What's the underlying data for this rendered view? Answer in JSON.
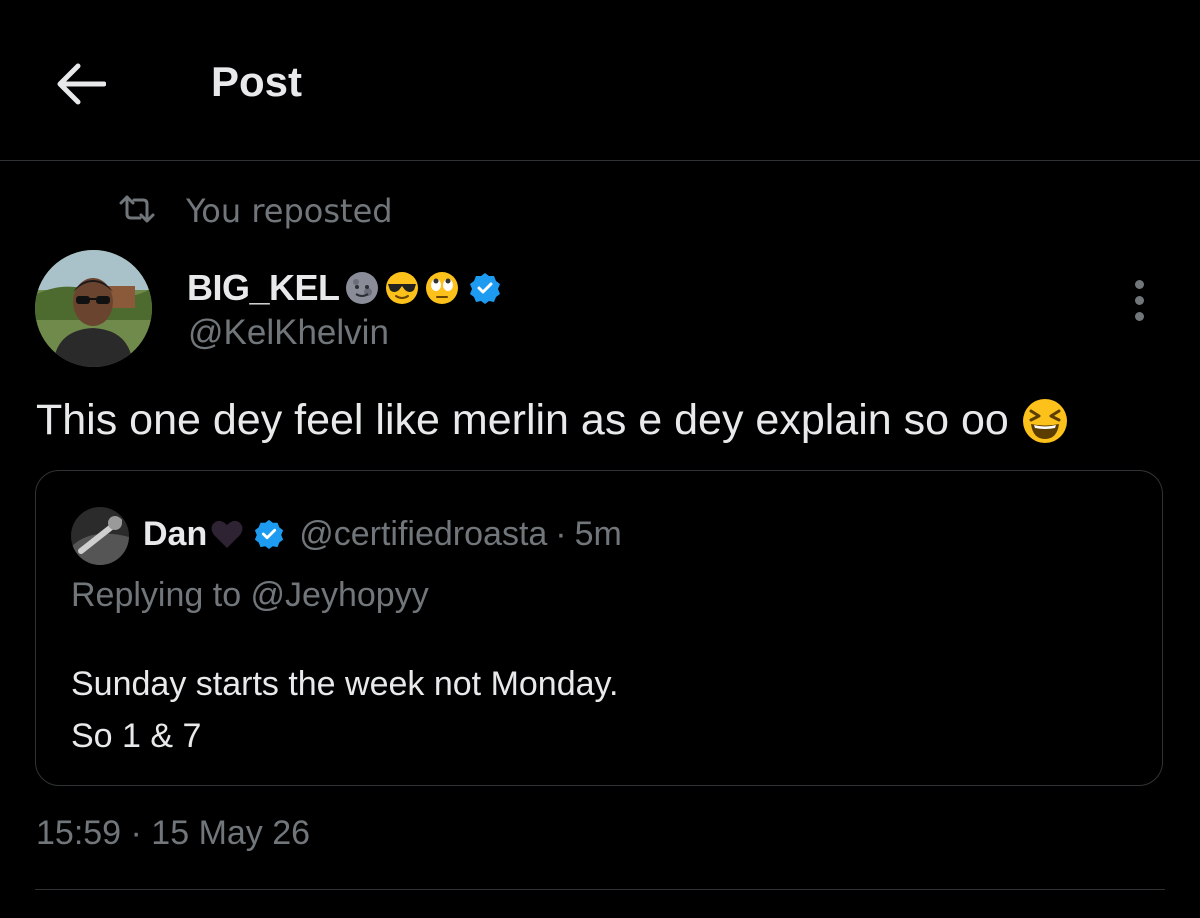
{
  "header": {
    "title": "Post",
    "back_icon": "arrow-left-icon"
  },
  "repost": {
    "icon": "repost-icon",
    "text": "You reposted"
  },
  "author": {
    "name": "BIG_KEL",
    "name_emojis": [
      "new-moon-face-emoji",
      "sunglasses-face-emoji",
      "eye-roll-face-emoji"
    ],
    "verified": true,
    "handle": "@KelKhelvin",
    "more_icon": "more-vertical-icon"
  },
  "tweet": {
    "text": "This one dey feel like merlin as e dey explain so oo",
    "trailing_emoji": "laughing-squint-face-emoji"
  },
  "quote": {
    "name": "Dan",
    "name_emoji": "black-heart-emoji",
    "verified": true,
    "handle": "@certifiedroasta",
    "separator": "·",
    "time": "5m",
    "replying_to": "Replying to @Jeyhopyy",
    "text_line1": "Sunday starts the week not Monday.",
    "text_line2": "So 1 & 7"
  },
  "timestamp": "15:59 · 15 May 26",
  "colors": {
    "background": "#000000",
    "primary_text": "#e7e9ea",
    "secondary_text": "#71767b",
    "divider": "#2f3336",
    "verified_blue": "#1d9bf0"
  }
}
